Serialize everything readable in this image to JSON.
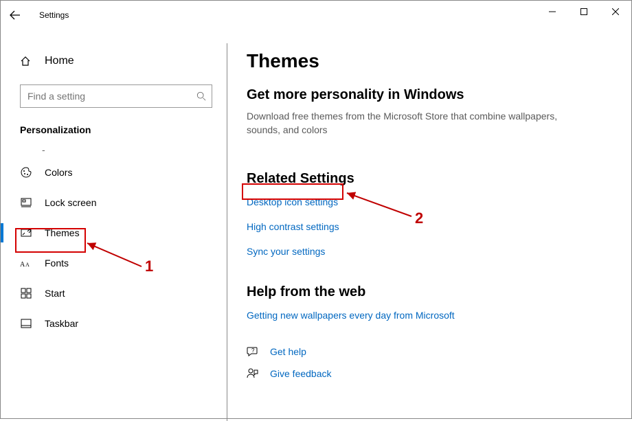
{
  "app": {
    "title": "Settings"
  },
  "sidebar": {
    "home_label": "Home",
    "search_placeholder": "Find a setting",
    "section": "Personalization",
    "items": [
      {
        "label": "-"
      },
      {
        "label": "Colors"
      },
      {
        "label": "Lock screen"
      },
      {
        "label": "Themes"
      },
      {
        "label": "Fonts"
      },
      {
        "label": "Start"
      },
      {
        "label": "Taskbar"
      }
    ]
  },
  "main": {
    "title": "Themes",
    "subhead": "Get more personality in Windows",
    "desc": "Download free themes from the Microsoft Store that combine wallpapers, sounds, and colors",
    "related_title": "Related Settings",
    "related_links": [
      "Desktop icon settings",
      "High contrast settings",
      "Sync your settings"
    ],
    "help_title": "Help from the web",
    "help_link": "Getting new wallpapers every day from Microsoft",
    "get_help": "Get help",
    "give_feedback": "Give feedback"
  },
  "annotations": {
    "label1": "1",
    "label2": "2"
  }
}
